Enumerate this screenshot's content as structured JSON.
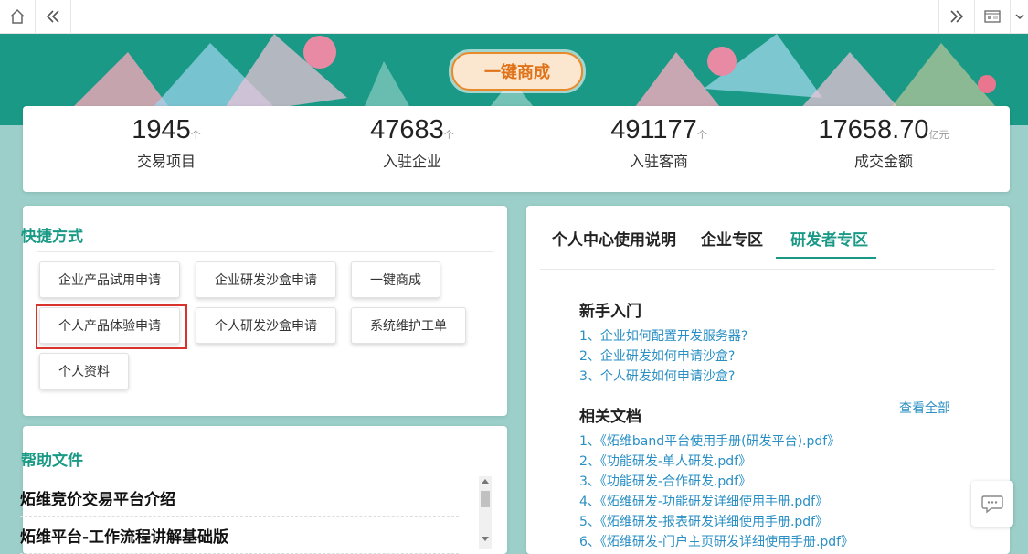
{
  "topbar": {
    "home_icon": "home-icon",
    "back_icon": "double-left-icon",
    "forward_icon": "double-right-icon",
    "panel_icon": "panel-icon",
    "menu_icon": "chevron-down-icon"
  },
  "banner": {
    "cta_label": "一键商成"
  },
  "stats": [
    {
      "value": "1945",
      "unit": "个",
      "label": "交易项目"
    },
    {
      "value": "47683",
      "unit": "个",
      "label": "入驻企业"
    },
    {
      "value": "491177",
      "unit": "个",
      "label": "入驻客商"
    },
    {
      "value": "17658.70",
      "unit": "亿元",
      "label": "成交金额"
    }
  ],
  "shortcuts": {
    "title": "快捷方式",
    "buttons": [
      "企业产品试用申请",
      "企业研发沙盒申请",
      "一键商成",
      "个人产品体验申请",
      "个人研发沙盒申请",
      "系统维护工单",
      "个人资料"
    ]
  },
  "help": {
    "title": "帮助文件",
    "items": [
      "炻维竞价交易平台介绍",
      "炻维平台-工作流程讲解基础版"
    ]
  },
  "tabs": [
    "个人中心使用说明",
    "企业专区",
    "研发者专区"
  ],
  "active_tab": "研发者专区",
  "beginner": {
    "title": "新手入门",
    "links": [
      "1、企业如何配置开发服务器?",
      "2、企业研发如何申请沙盒?",
      "3、个人研发如何申请沙盒?"
    ]
  },
  "docs": {
    "title": "相关文档",
    "view_all": "查看全部",
    "links": [
      "1、《炻维band平台使用手册(研发平台).pdf》",
      "2、《功能研发-单人研发.pdf》",
      "3、《功能研发-合作研发.pdf》",
      "4、《炻维研发-功能研发详细使用手册.pdf》",
      "5、《炻维研发-报表研发详细使用手册.pdf》",
      "6、《炻维研发-门户主页研发详细使用手册.pdf》"
    ]
  },
  "colors": {
    "accent": "#1a9a86",
    "link": "#2a8fc4",
    "cta": "#e0731a",
    "highlight": "#d9312b"
  }
}
